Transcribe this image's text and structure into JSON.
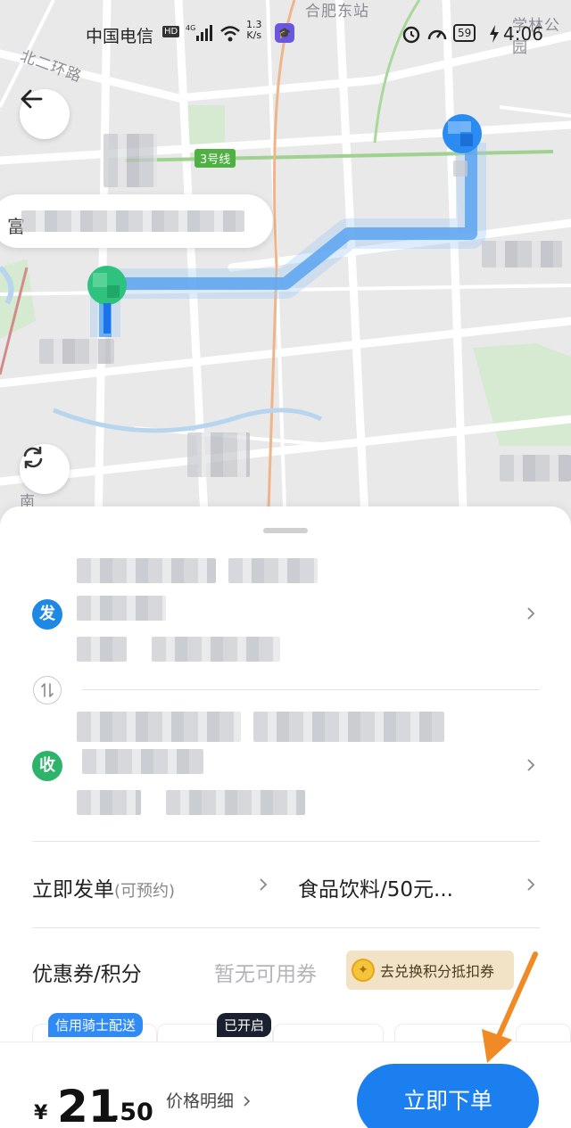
{
  "status_bar": {
    "carrier": "中国电信",
    "hd": "HD",
    "net_speed_value": "1.3",
    "net_speed_unit": "K/s",
    "battery": "59",
    "time": "4:06"
  },
  "map": {
    "labels": {
      "station": "合肥东站",
      "road_north": "北二环路",
      "school": "学林公园",
      "south": "南"
    },
    "metro_line": "3号线",
    "bubble_text": "富",
    "route_color": "#3a8ff0",
    "start_color": "#2ec27e",
    "end_color": "#2a8cf0"
  },
  "sheet": {
    "sender_icon": "发",
    "receiver_icon": "收",
    "dispatch_label": "立即发单",
    "dispatch_sub": "(可预约)",
    "goods_label": "食品饮料/50元...",
    "coupon_label": "优惠券/积分",
    "coupon_value": "暂无可用券",
    "points_button": "去兑换积分抵扣券",
    "tag_credit": "信用骑士配送",
    "tag_enabled": "已开启"
  },
  "bottom": {
    "currency": "¥",
    "price_int": "21",
    "price_dec": ".50",
    "price_detail": "价格明细",
    "order_button": "立即下单"
  },
  "colors": {
    "accent": "#1b7ff0",
    "sender": "#1e88e5",
    "receiver": "#2eb36b",
    "annotation_arrow": "#f08a24"
  }
}
